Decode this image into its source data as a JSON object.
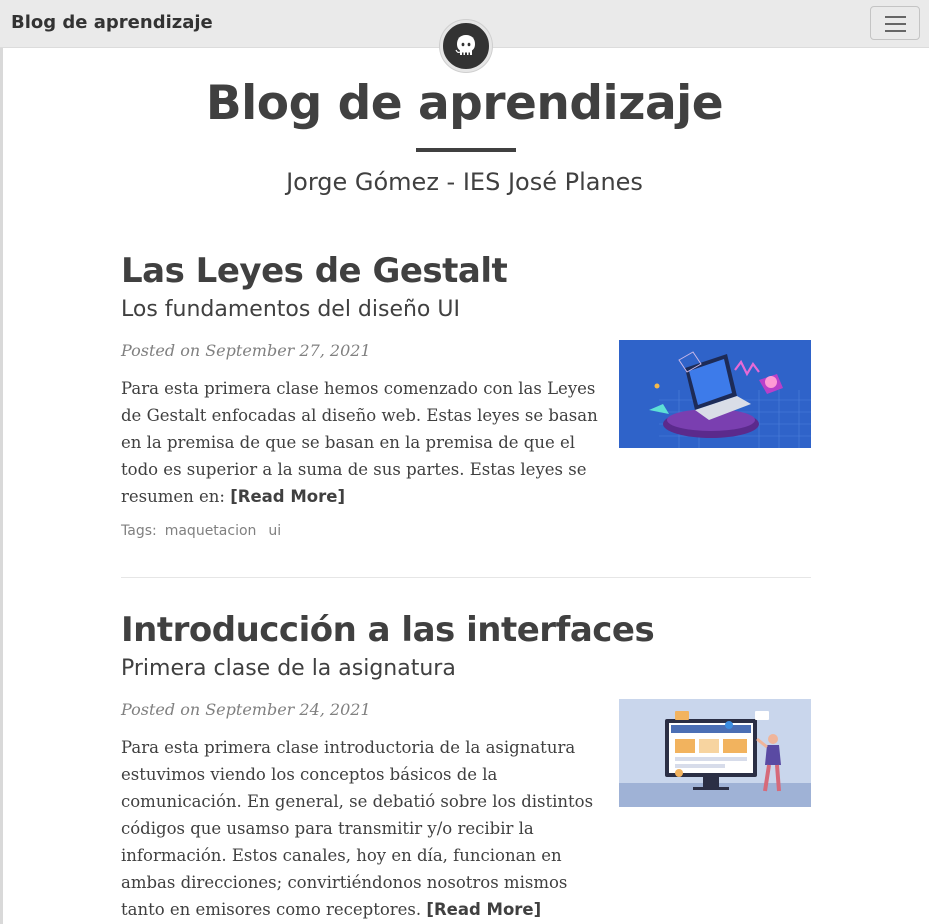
{
  "navbar": {
    "brand": "Blog de aprendizaje",
    "menu_icon": "hamburger-menu-icon",
    "avatar_icon": "github-octocat-icon"
  },
  "header": {
    "title": "Blog de aprendizaje",
    "subtitle": "Jorge Gómez - IES José Planes"
  },
  "posts": [
    {
      "title": "Las Leyes de Gestalt",
      "subtitle": "Los fundamentos del diseño UI",
      "meta": "Posted on September 27, 2021",
      "excerpt": "Para esta primera clase hemos comenzado con las Leyes de Gestalt enfocadas al diseño web. Estas leyes se basan en la premisa de que se basan en la premisa de que el todo es superior a la suma de sus partes. Estas leyes se resumen en:",
      "read_more": "[Read More]",
      "tags_label": "Tags:",
      "tags": [
        "maquetacion",
        "ui"
      ]
    },
    {
      "title": "Introducción a las interfaces",
      "subtitle": "Primera clase de la asignatura",
      "meta": "Posted on September 24, 2021",
      "excerpt": "Para esta primera clase introductoria de la asignatura estuvimos viendo los conceptos básicos de la comunicación. En general, se debatió sobre los distintos códigos que usamso para transmitir y/o recibir la información. Estos canales, hoy en día, funcionan en ambas direcciones; convirtiéndonos nosotros mismos tanto en emisores como receptores.",
      "read_more": "[Read More]"
    }
  ],
  "colors": {
    "text": "#404040",
    "muted": "#808080",
    "navbar_bg": "#eaeaea"
  }
}
